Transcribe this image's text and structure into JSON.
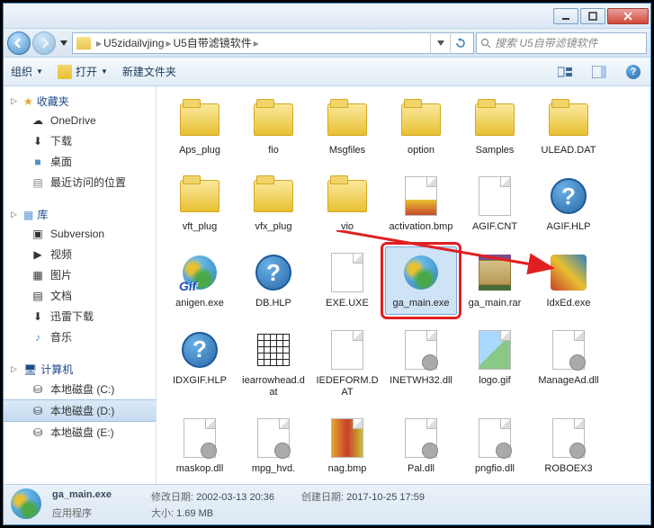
{
  "path": {
    "parts": [
      "U5zidailvjing",
      "U5自带滤镜软件"
    ]
  },
  "search": {
    "placeholder": "搜索 U5自带滤镜软件"
  },
  "toolbar": {
    "organize": "组织",
    "open": "打开",
    "newfolder": "新建文件夹"
  },
  "sidebar": {
    "favorites": {
      "label": "收藏夹",
      "items": [
        "OneDrive",
        "下载",
        "桌面",
        "最近访问的位置"
      ]
    },
    "libraries": {
      "label": "库",
      "items": [
        "Subversion",
        "视频",
        "图片",
        "文档",
        "迅雷下载",
        "音乐"
      ]
    },
    "computer": {
      "label": "计算机",
      "items": [
        "本地磁盘 (C:)",
        "本地磁盘 (D:)",
        "本地磁盘 (E:)"
      ]
    }
  },
  "files": [
    {
      "name": "Aps_plug",
      "type": "folder"
    },
    {
      "name": "fio",
      "type": "folder"
    },
    {
      "name": "Msgfiles",
      "type": "folder"
    },
    {
      "name": "option",
      "type": "folder"
    },
    {
      "name": "Samples",
      "type": "folder"
    },
    {
      "name": "ULEAD.DAT",
      "type": "folder"
    },
    {
      "name": "vft_plug",
      "type": "folder"
    },
    {
      "name": "vfx_plug",
      "type": "folder"
    },
    {
      "name": "vio",
      "type": "folder"
    },
    {
      "name": "activation.bmp",
      "type": "bmp"
    },
    {
      "name": "AGIF.CNT",
      "type": "file"
    },
    {
      "name": "AGIF.HLP",
      "type": "help"
    },
    {
      "name": "anigen.exe",
      "type": "anigen"
    },
    {
      "name": "DB.HLP",
      "type": "help"
    },
    {
      "name": "EXE.UXE",
      "type": "file"
    },
    {
      "name": "ga_main.exe",
      "type": "globe",
      "selected": true,
      "highlighted": true
    },
    {
      "name": "ga_main.rar",
      "type": "rar"
    },
    {
      "name": "IdxEd.exe",
      "type": "idxed"
    },
    {
      "name": "IDXGIF.HLP",
      "type": "help"
    },
    {
      "name": "iearrowhead.dat",
      "type": "grid"
    },
    {
      "name": "IEDEFORM.DAT",
      "type": "file"
    },
    {
      "name": "INETWH32.dll",
      "type": "dll"
    },
    {
      "name": "logo.gif",
      "type": "img"
    },
    {
      "name": "ManageAd.dll",
      "type": "dll"
    },
    {
      "name": "maskop.dll",
      "type": "dll"
    },
    {
      "name": "mpg_hvd.",
      "type": "dll"
    },
    {
      "name": "nag.bmp",
      "type": "bmp2"
    },
    {
      "name": "Pal.dll",
      "type": "dll"
    },
    {
      "name": "pngfio.dll",
      "type": "dll"
    },
    {
      "name": "ROBOEX3",
      "type": "dll"
    }
  ],
  "status": {
    "filename": "ga_main.exe",
    "type": "应用程序",
    "moddate_label": "修改日期:",
    "moddate": "2002-03-13 20:36",
    "size_label": "大小:",
    "size": "1.69 MB",
    "created_label": "创建日期:",
    "created": "2017-10-25 17:59"
  }
}
